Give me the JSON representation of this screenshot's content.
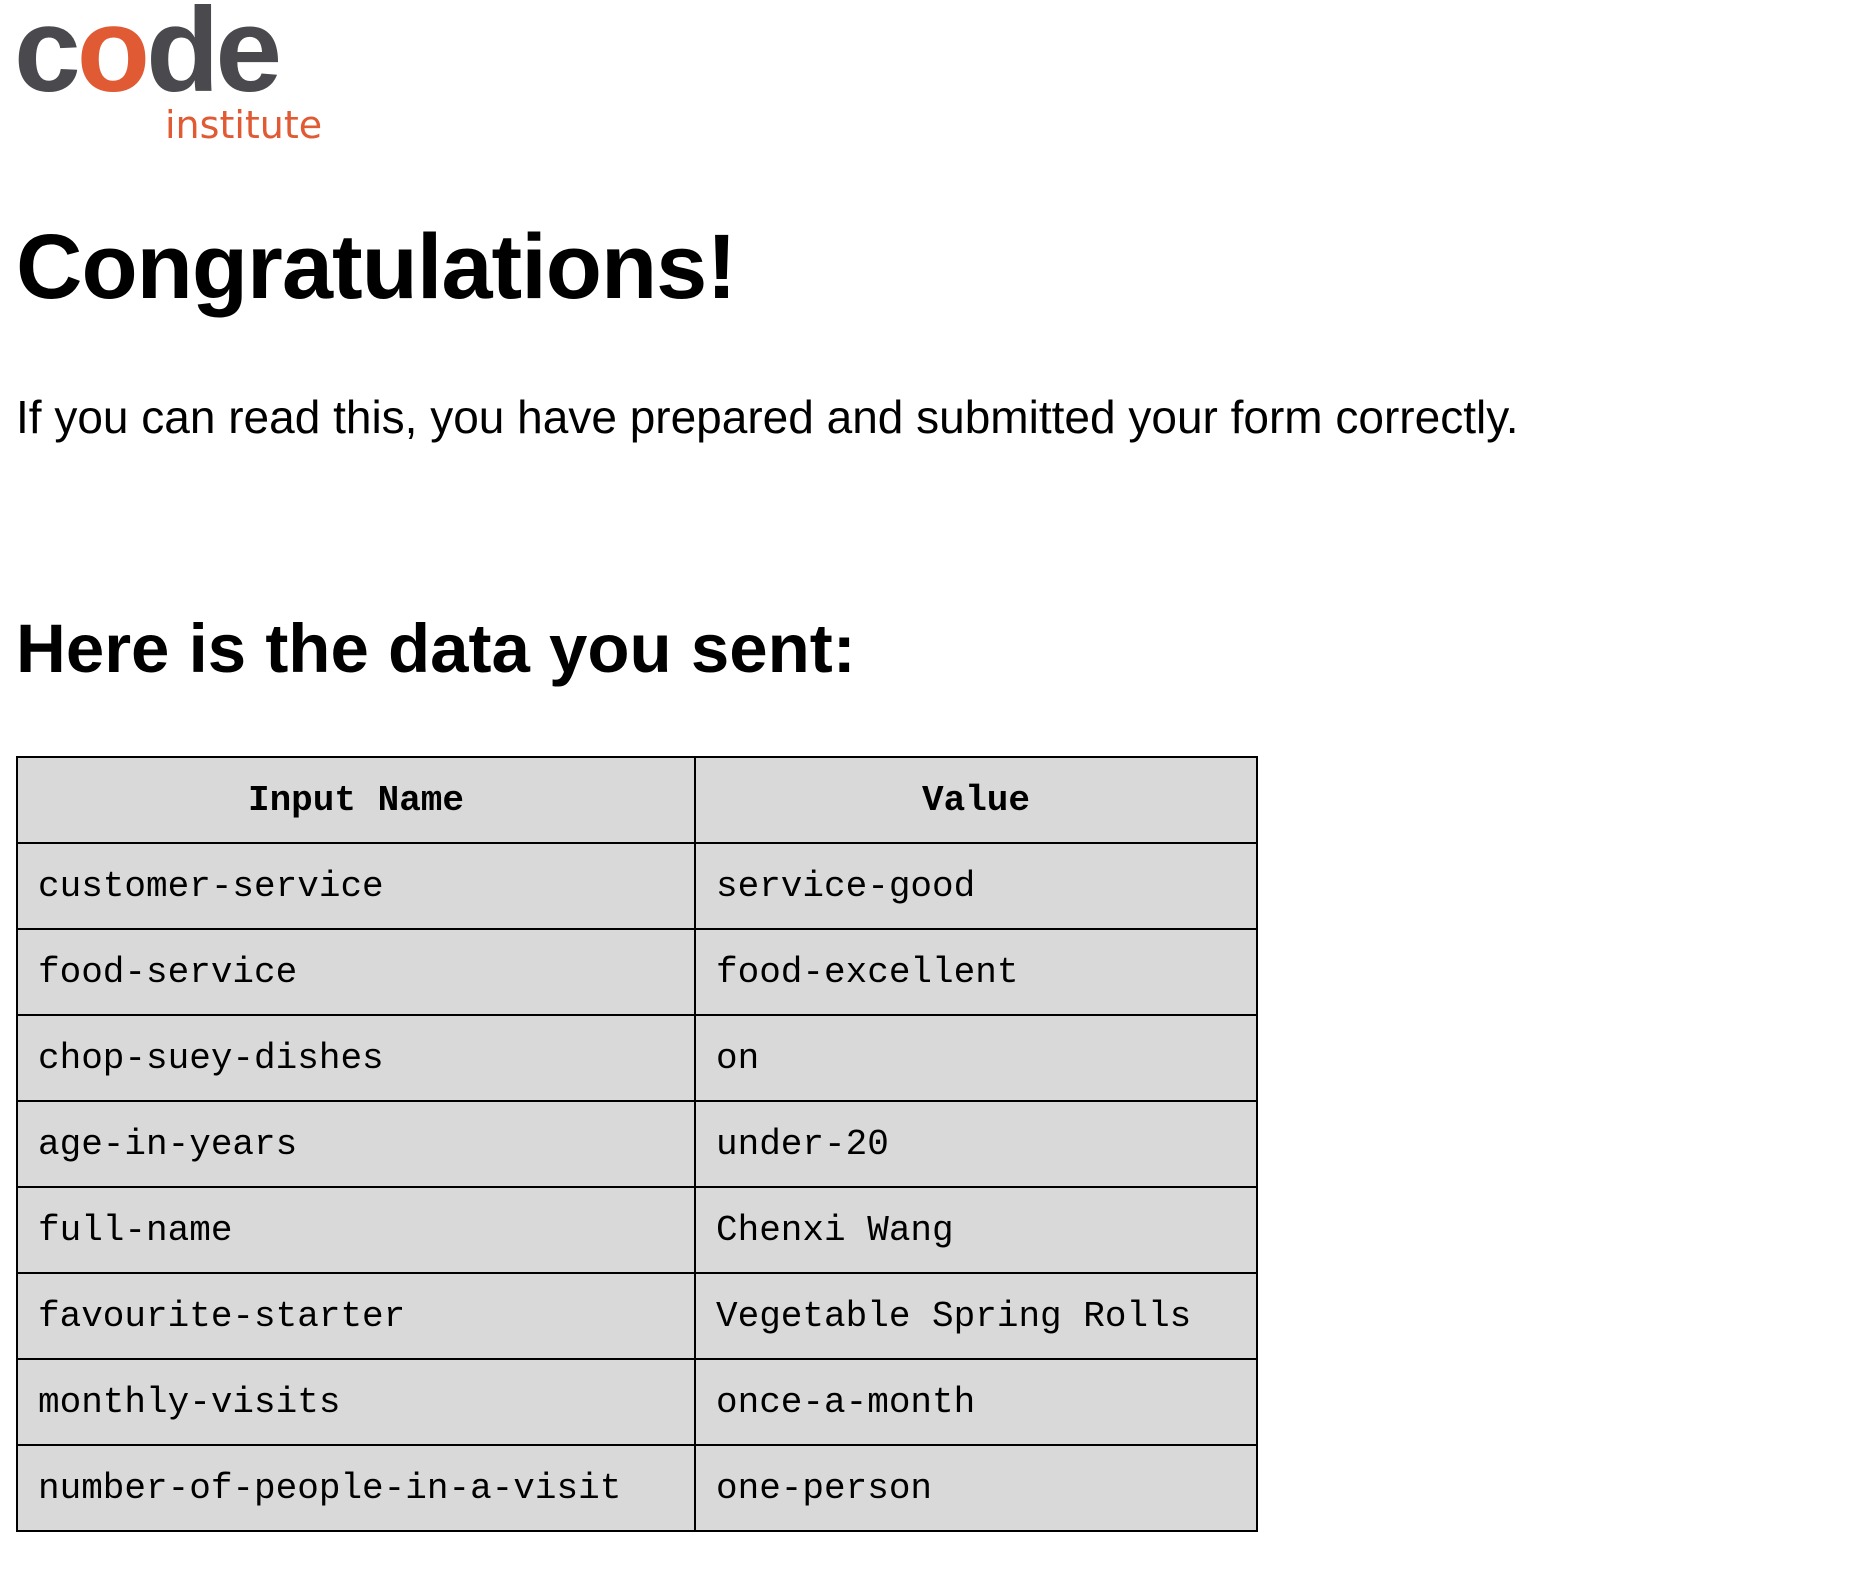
{
  "logo": {
    "word_prefix": "c",
    "word_accent": "o",
    "word_suffix": "de",
    "sub": "institute",
    "colors": {
      "dark": "#4a4a4e",
      "accent": "#e05a33"
    }
  },
  "heading": "Congratulations!",
  "intro": "If you can read this, you have prepared and submitted your form correctly.",
  "subheading": "Here is the data you sent:",
  "table": {
    "headers": {
      "name": "Input Name",
      "value": "Value"
    },
    "rows": [
      {
        "name": "customer-service",
        "value": "service-good"
      },
      {
        "name": "food-service",
        "value": "food-excellent"
      },
      {
        "name": "chop-suey-dishes",
        "value": "on"
      },
      {
        "name": "age-in-years",
        "value": "under-20"
      },
      {
        "name": "full-name",
        "value": "Chenxi Wang"
      },
      {
        "name": "favourite-starter",
        "value": "Vegetable Spring Rolls"
      },
      {
        "name": "monthly-visits",
        "value": "once-a-month"
      },
      {
        "name": "number-of-people-in-a-visit",
        "value": "one-person"
      }
    ],
    "background": "#d9d9d9",
    "border": "#000000"
  }
}
